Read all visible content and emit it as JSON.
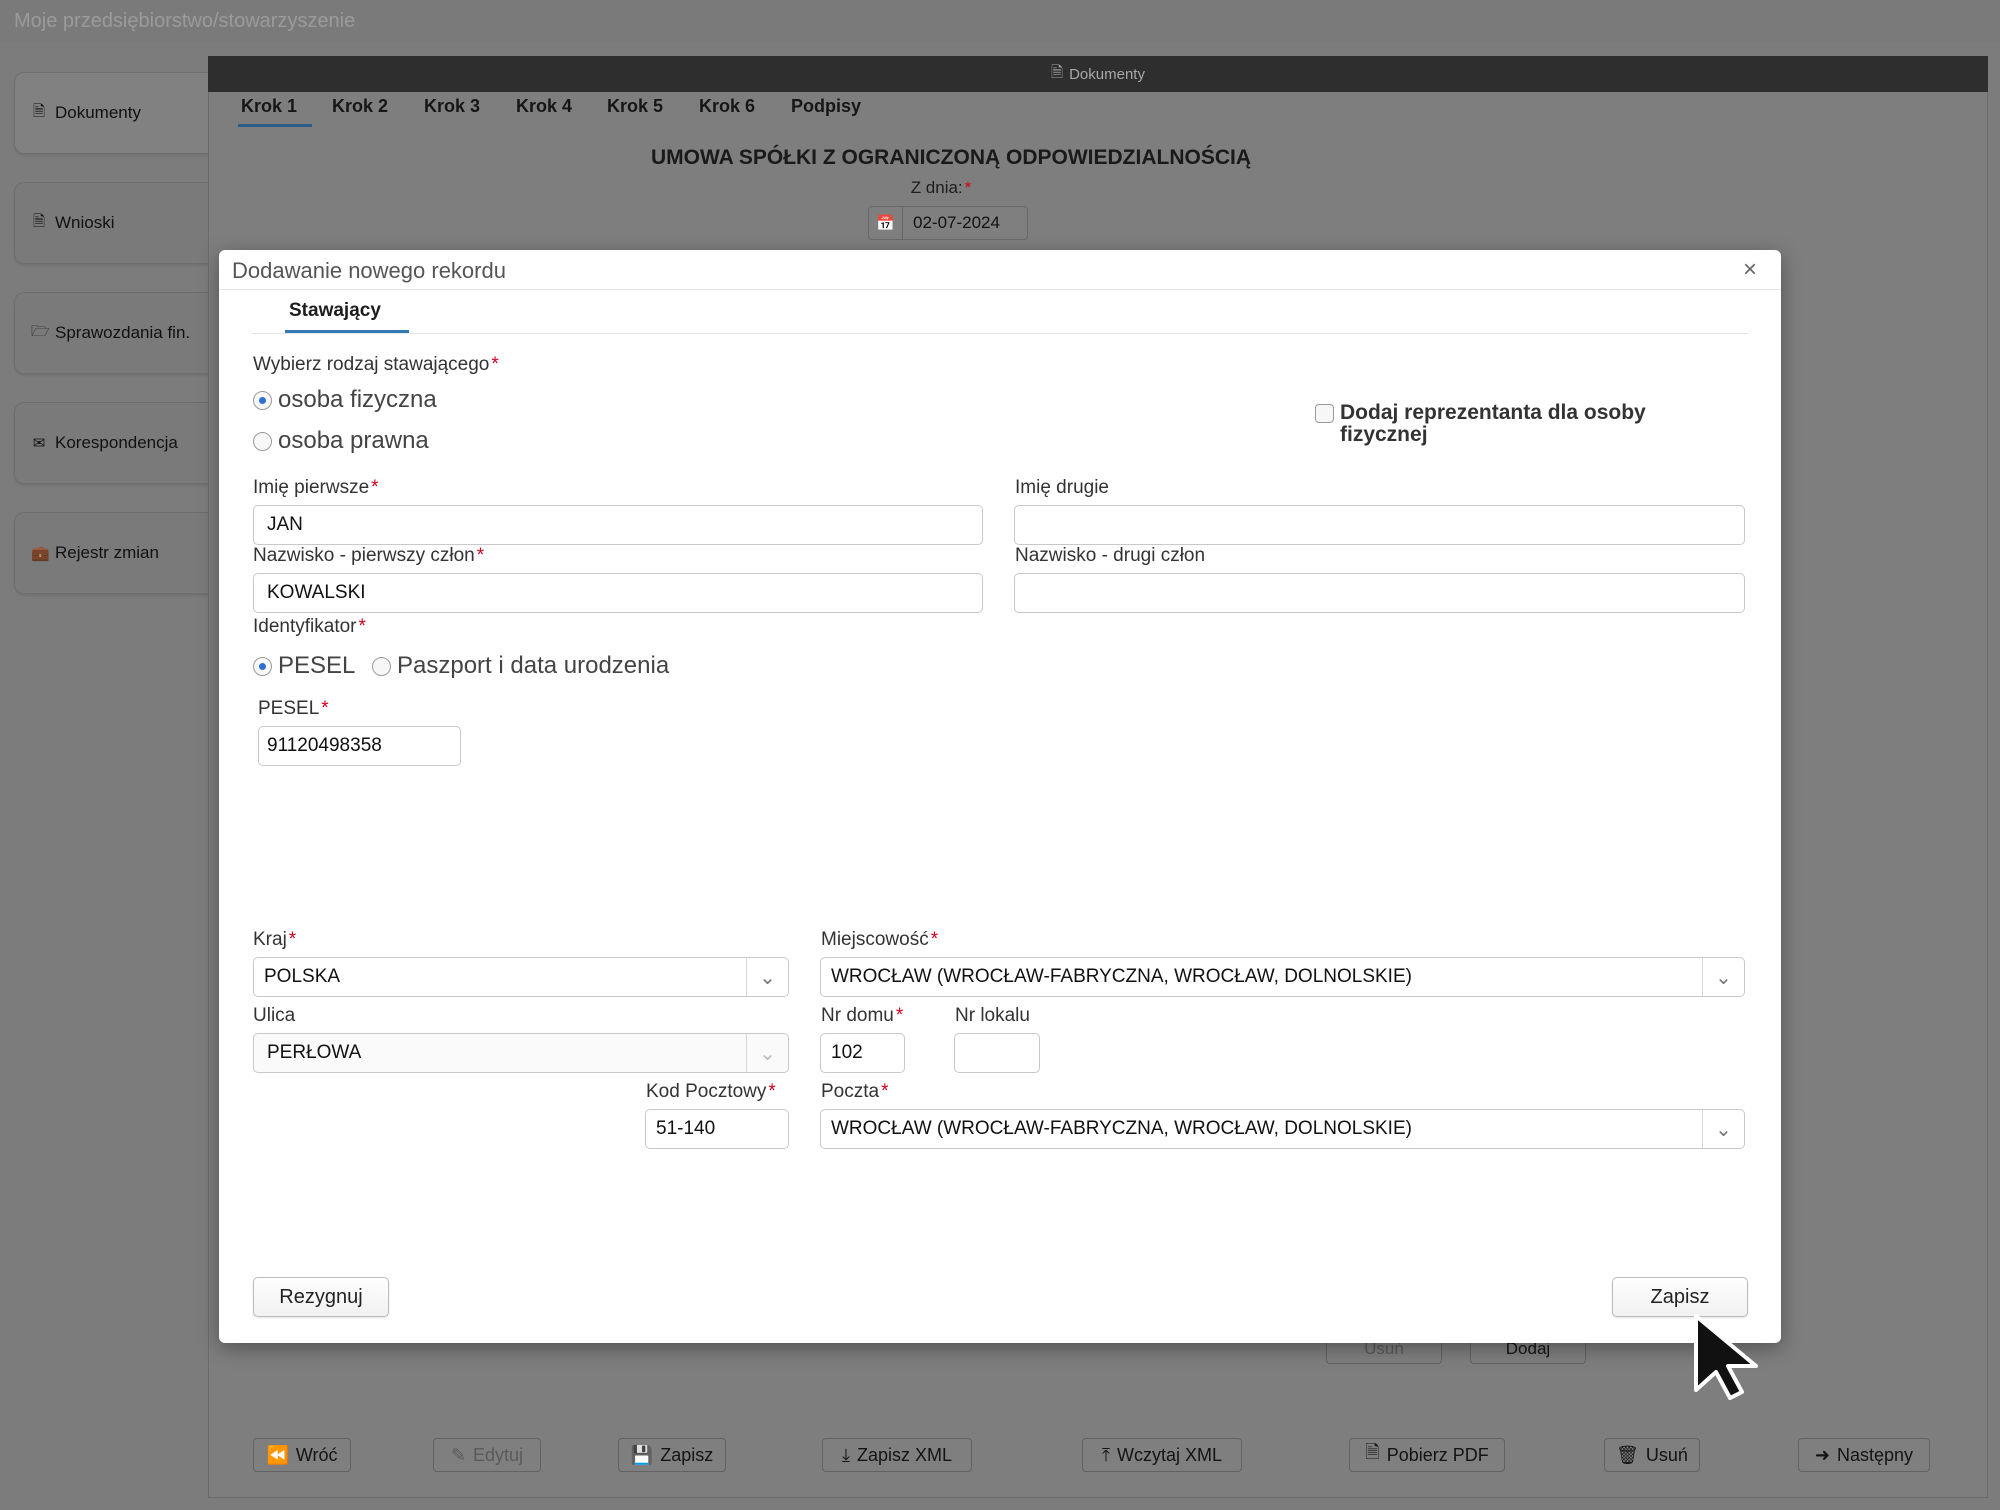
{
  "app": {
    "title": "Moje przedsiębiorstwo/stowarzyszenie"
  },
  "sidebar": {
    "items": [
      {
        "label": "Dokumenty",
        "icon": "document-icon"
      },
      {
        "label": "Wnioski",
        "icon": "request-icon"
      },
      {
        "label": "Sprawozdania fin.",
        "icon": "folder-icon"
      },
      {
        "label": "Korespondencja",
        "icon": "envelope-icon"
      },
      {
        "label": "Rejestr zmian",
        "icon": "briefcase-icon"
      }
    ]
  },
  "panel": {
    "header": "Dokumenty",
    "steps": [
      "Krok 1",
      "Krok 2",
      "Krok 3",
      "Krok 4",
      "Krok 5",
      "Krok 6",
      "Podpisy"
    ],
    "active_step": "Krok 1",
    "doc_title": "UMOWA SPÓŁKI Z OGRANICZONĄ ODPOWIEDZIALNOŚCIĄ",
    "date_label": "Z dnia:",
    "date_value": "02-07-2024",
    "partial_buttons": {
      "remove": "Usuń",
      "add": "Dodaj"
    },
    "footer_buttons": {
      "back": "Wróć",
      "edit": "Edytuj",
      "save": "Zapisz",
      "save_xml": "Zapisz XML",
      "load_xml": "Wczytaj XML",
      "download_pdf": "Pobierz PDF",
      "delete": "Usuń",
      "next": "Następny"
    }
  },
  "modal": {
    "title": "Dodawanie nowego rekordu",
    "tab": "Stawający",
    "type_label": "Wybierz rodzaj stawającego",
    "type_options": [
      "osoba fizyczna",
      "osoba prawna"
    ],
    "type_selected": "osoba fizyczna",
    "representative_label": "Dodaj reprezentanta dla osoby fizycznej",
    "representative_checked": false,
    "first_name": {
      "label": "Imię pierwsze",
      "value": "JAN"
    },
    "second_name": {
      "label": "Imię drugie",
      "value": ""
    },
    "surname_1": {
      "label": "Nazwisko - pierwszy człon",
      "value": "KOWALSKI"
    },
    "surname_2": {
      "label": "Nazwisko - drugi człon",
      "value": ""
    },
    "identifier_label": "Identyfikator",
    "identifier_options": [
      "PESEL",
      "Paszport i data urodzenia"
    ],
    "identifier_selected": "PESEL",
    "pesel": {
      "label": "PESEL",
      "value": "91120498358"
    },
    "country": {
      "label": "Kraj",
      "value": "POLSKA"
    },
    "city": {
      "label": "Miejscowość",
      "value": "WROCŁAW (WROCŁAW-FABRYCZNA, WROCŁAW, DOLNOLSKIE)"
    },
    "street": {
      "label": "Ulica",
      "value": "PERŁOWA"
    },
    "house_no": {
      "label": "Nr domu",
      "value": "102"
    },
    "apartment_no": {
      "label": "Nr lokalu",
      "value": ""
    },
    "postal_code": {
      "label": "Kod Pocztowy",
      "value": "51-140"
    },
    "post_office": {
      "label": "Poczta",
      "value": "WROCŁAW (WROCŁAW-FABRYCZNA, WROCŁAW, DOLNOLSKIE)"
    },
    "cancel_label": "Rezygnuj",
    "save_label": "Zapisz",
    "close_symbol": "×"
  },
  "colors": {
    "accent": "#337ab7",
    "required": "#d0021b",
    "overlay": "#7c7c7c",
    "panel_header": "#2e2e2e"
  }
}
